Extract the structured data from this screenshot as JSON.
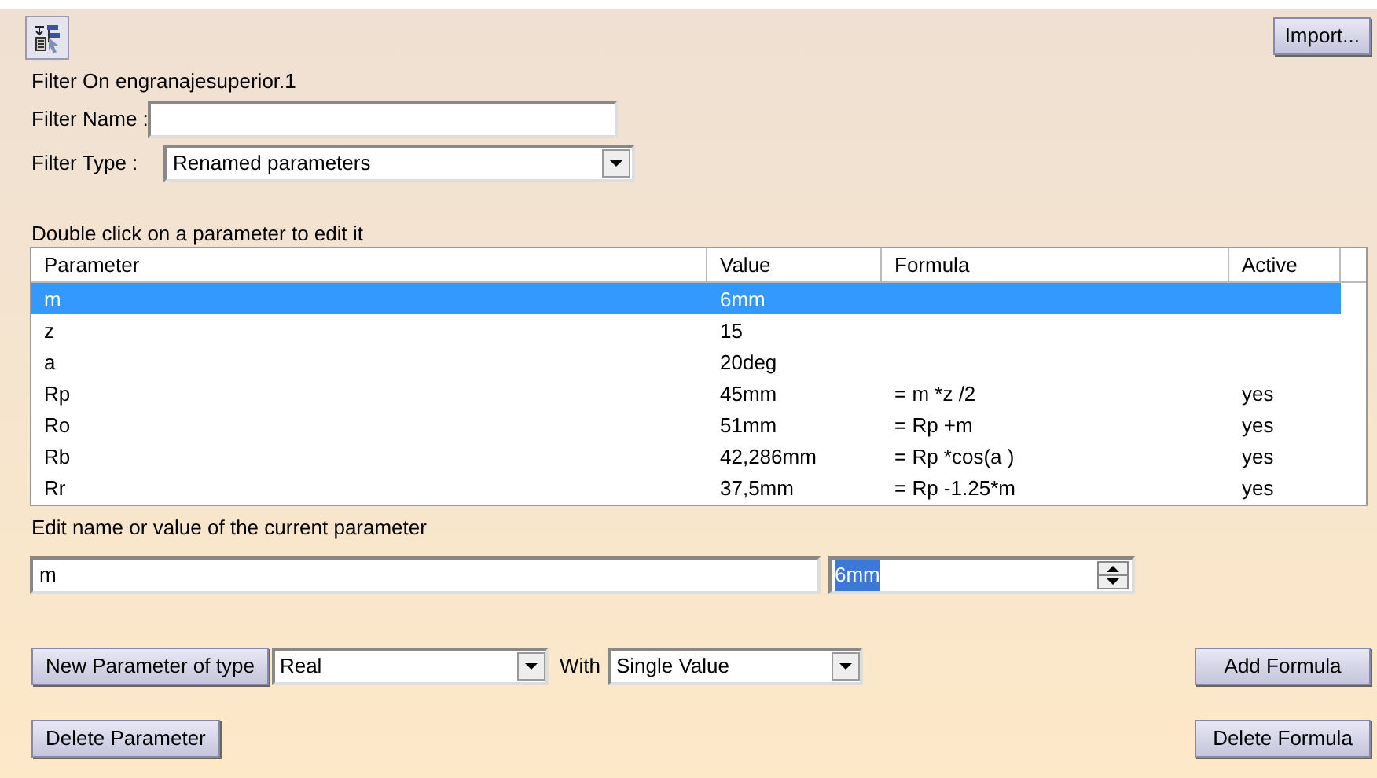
{
  "import_button": "Import...",
  "filter_on": "Filter On engranajesuperior.1",
  "filter_name": {
    "label": "Filter Name :"
  },
  "filter_type": {
    "label": "Filter Type :",
    "value": "Renamed parameters"
  },
  "table_caption": "Double click on a parameter to edit it",
  "table": {
    "columns": [
      "Parameter",
      "Value",
      "Formula",
      "Active"
    ],
    "rows": [
      {
        "cells": [
          "m",
          "6mm",
          "",
          ""
        ],
        "selected": true
      },
      {
        "cells": [
          "z",
          "15",
          "",
          ""
        ],
        "selected": false
      },
      {
        "cells": [
          "a",
          "20deg",
          "",
          ""
        ],
        "selected": false
      },
      {
        "cells": [
          "Rp",
          "45mm",
          "= m *z /2",
          "yes"
        ],
        "selected": false
      },
      {
        "cells": [
          "Ro",
          "51mm",
          "= Rp +m",
          "yes"
        ],
        "selected": false
      },
      {
        "cells": [
          "Rb",
          "42,286mm",
          "= Rp *cos(a )",
          "yes"
        ],
        "selected": false
      },
      {
        "cells": [
          "Rr",
          "37,5mm",
          "= Rp -1.25*m",
          "yes"
        ],
        "selected": false
      }
    ]
  },
  "edit_caption": "Edit name or value of the current parameter",
  "edit_name": "m",
  "edit_value": "6mm",
  "new_parameter_button": "New Parameter of type",
  "type_select": "Real",
  "with_label": "With",
  "with_select": "Single Value",
  "add_formula_button": "Add Formula",
  "delete_parameter_button": "Delete Parameter",
  "delete_formula_button": "Delete Formula"
}
